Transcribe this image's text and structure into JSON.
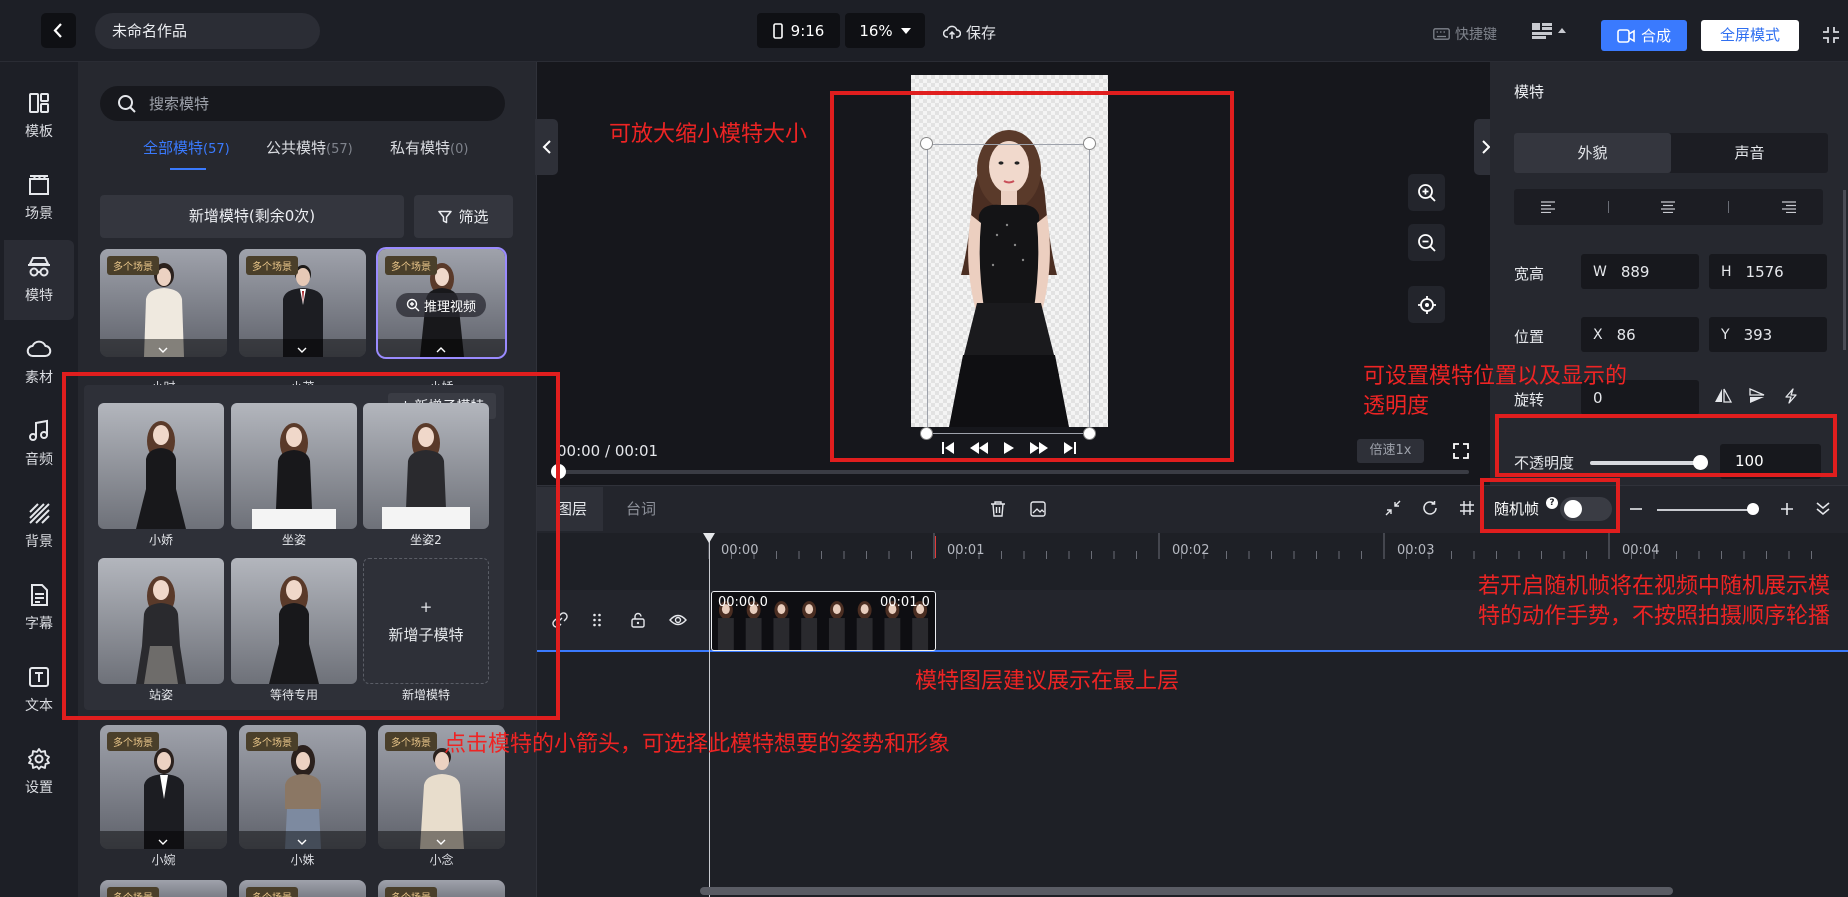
{
  "topbar": {
    "project_name": "未命名作品",
    "ratio": "9:16",
    "zoom": "16%",
    "save": "保存",
    "shortcut": "快捷键",
    "compose": "合成",
    "fullscreen": "全屏模式"
  },
  "nav": [
    {
      "label": "模板",
      "icon": "template-icon"
    },
    {
      "label": "场景",
      "icon": "scene-icon"
    },
    {
      "label": "模特",
      "icon": "model-icon"
    },
    {
      "label": "素材",
      "icon": "cloud-icon"
    },
    {
      "label": "音频",
      "icon": "music-icon"
    },
    {
      "label": "背景",
      "icon": "background-icon"
    },
    {
      "label": "字幕",
      "icon": "subtitle-icon"
    },
    {
      "label": "文本",
      "icon": "text-icon"
    },
    {
      "label": "设置",
      "icon": "gear-icon"
    }
  ],
  "panel": {
    "search_placeholder": "搜索模特",
    "tabs": [
      {
        "label": "全部模特",
        "count": "(57)"
      },
      {
        "label": "公共模特",
        "count": "(57)"
      },
      {
        "label": "私有模特",
        "count": "(0)"
      }
    ],
    "add_model": "新增模特(剩余0次)",
    "filter": "筛选",
    "badge": "多个场景",
    "infer": "推理视频",
    "models_top": [
      "小时",
      "小茂",
      "小娇"
    ],
    "models_bottom": [
      "小婉",
      "小姝",
      "小念"
    ],
    "sub": {
      "add_top": "新增子模特",
      "items": [
        "小娇",
        "坐姿",
        "坐姿2",
        "站姿",
        "等待专用"
      ],
      "new_label": "新增子模特",
      "new_name": "新增模特"
    }
  },
  "canvas": {
    "time": "00:00 / 00:01",
    "speed": "倍速1x"
  },
  "right": {
    "title": "模特",
    "tabs": [
      "外貌",
      "声音"
    ],
    "size_label": "宽高",
    "w_key": "W",
    "w": "889",
    "h_key": "H",
    "h": "1576",
    "pos_label": "位置",
    "x_key": "X",
    "x": "86",
    "y_key": "Y",
    "y": "393",
    "rotate_label": "旋转",
    "rotate": "0",
    "opacity_label": "不透明度",
    "opacity": "100"
  },
  "timeline": {
    "tabs": [
      "图层",
      "台词"
    ],
    "random_label": "随机帧",
    "random_help": "?",
    "ruler": [
      "00:00",
      "00:01",
      "00:02",
      "00:03",
      "00:04"
    ],
    "clip_start": "00:00.0",
    "clip_end": "00:01.0"
  },
  "annotations": {
    "zoom_note": "可放大缩小模特大小",
    "position_note": "可设置模特位置以及显示的透明度",
    "random_note": "若开启随机帧将在视频中随机展示模特的动作手势，不按照拍摄顺序轮播",
    "layer_note": "模特图层建议展示在最上层",
    "arrow_note": "点击模特的小箭头，可选择此模特想要的姿势和形象"
  }
}
